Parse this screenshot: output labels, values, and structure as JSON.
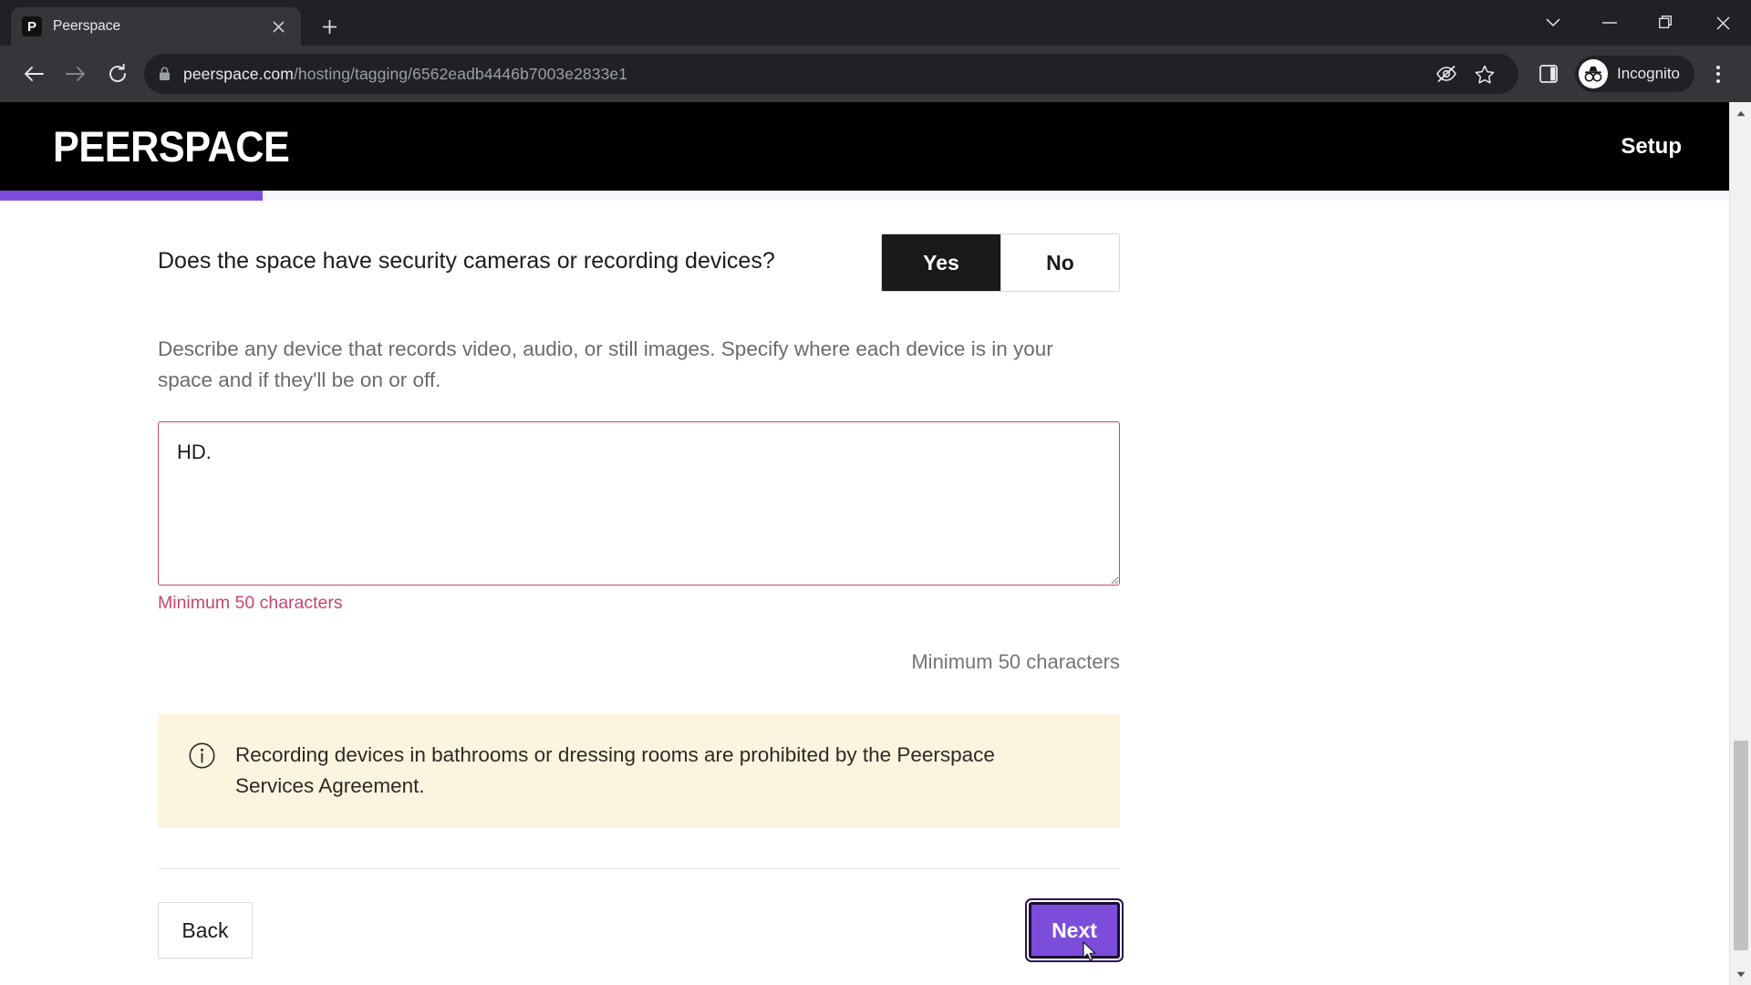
{
  "browser": {
    "tab": {
      "title": "Peerspace",
      "favicon_letter": "P",
      "favicon_name": "peerspace-favicon"
    },
    "newtab_tooltip": "New tab",
    "url": {
      "domain": "peerspace.com",
      "path": "/hosting/tagging/6562eadb4446b7003e2833e1"
    },
    "profile_label": "Incognito",
    "window_controls": [
      "tab-search",
      "minimize",
      "restore",
      "close"
    ]
  },
  "site": {
    "logo": "PEERSPACE",
    "section_label": "Setup",
    "progress_percent": 15,
    "accent_purple": "#7c4ddb",
    "header_bg": "#000000"
  },
  "form": {
    "question": "Does the space have security cameras or recording devices?",
    "toggle": {
      "options": [
        "Yes",
        "No"
      ],
      "selected": "Yes"
    },
    "help_text": "Describe any device that records video, audio, or still images. Specify where each device is in your space and if they'll be on or off.",
    "textarea": {
      "value": "HD.",
      "placeholder": ""
    },
    "error_text": "Minimum 50 characters",
    "counter_text": "Minimum 50 characters",
    "error_color": "#c9456b",
    "notice": {
      "icon": "info-circle-icon",
      "text": "Recording devices in bathrooms or dressing rooms are prohibited by the Peerspace Services Agreement.",
      "bg": "#fdf4e0"
    },
    "buttons": {
      "back": "Back",
      "next": "Next"
    }
  }
}
